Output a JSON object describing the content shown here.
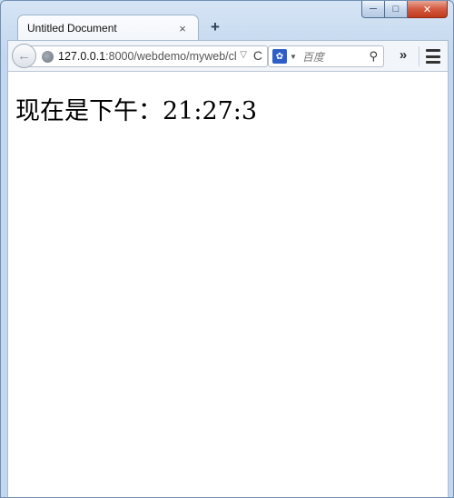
{
  "tab": {
    "title": "Untitled Document",
    "close_glyph": "×",
    "new_tab_glyph": "+"
  },
  "window_controls": {
    "minimize_glyph": "─",
    "maximize_glyph": "□",
    "close_glyph": "✕"
  },
  "toolbar": {
    "back_glyph": "←",
    "url_host": "127.0.0.1",
    "url_rest": ":8000/webdemo/myweb/cl",
    "url_dropdown_glyph": "▽",
    "reload_glyph": "C",
    "search_engine_icon": "baidu-paw-icon",
    "search_placeholder": "百度",
    "search_go_glyph": "⚲",
    "overflow_glyph": "»"
  },
  "page": {
    "time_text": "现在是下午：21:27:3"
  },
  "colors": {
    "chrome_blue": "#c3d7ee",
    "close_red": "#c23a1c",
    "baidu_blue": "#2e5fc7"
  }
}
